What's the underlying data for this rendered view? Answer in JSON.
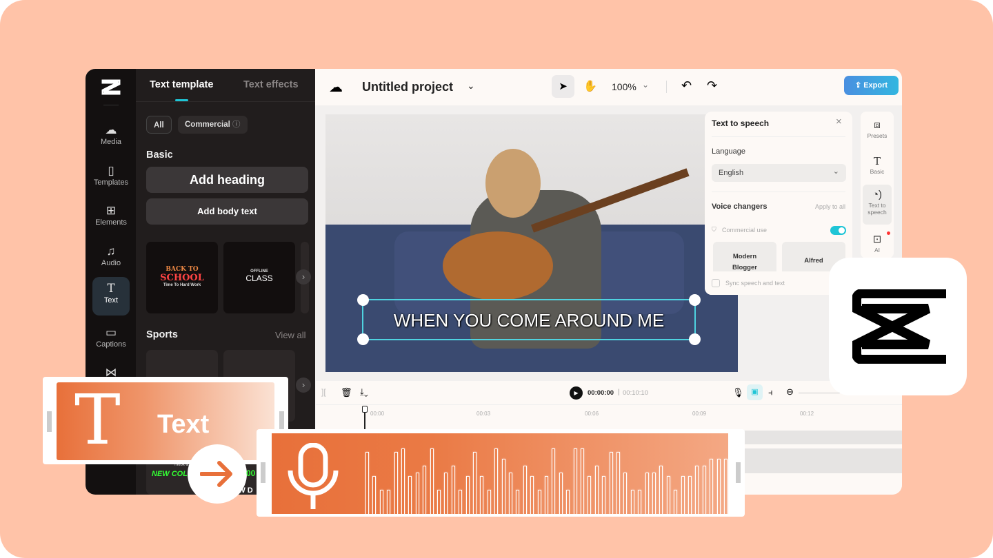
{
  "sidebar": {
    "items": [
      {
        "label": "Media",
        "icon": "cloud-upload-icon"
      },
      {
        "label": "Templates",
        "icon": "templates-icon"
      },
      {
        "label": "Elements",
        "icon": "elements-icon"
      },
      {
        "label": "Audio",
        "icon": "music-note-icon"
      },
      {
        "label": "Text",
        "icon": "text-icon",
        "active": true
      },
      {
        "label": "Captions",
        "icon": "captions-icon"
      },
      {
        "label": "Transitions",
        "icon": "transitions-icon"
      }
    ]
  },
  "panel": {
    "tabs": [
      "Text template",
      "Text effects"
    ],
    "filters": [
      "All",
      "Commercial"
    ],
    "basic_heading": "Basic",
    "add_heading": "Add heading",
    "add_body": "Add body text",
    "templates": [
      {
        "line1": "BACK TO",
        "line2": "SCHOOL",
        "line3": "Time To Hard Work"
      },
      {
        "line1": "OFFLINE",
        "line2": "CLASS"
      }
    ],
    "sports_heading": "Sports",
    "view_all": "View all",
    "sports_thumb_text": [
      "Tiktok & Bro",
      "NEW COLLEC",
      "00",
      "EW D"
    ]
  },
  "header": {
    "project_title": "Untitled project",
    "zoom": "100%",
    "export": "Export"
  },
  "canvas": {
    "caption": "WHEN  YOU COME AROUND ME"
  },
  "tts": {
    "title": "Text to speech",
    "language_label": "Language",
    "language_value": "English",
    "voice_label": "Voice changers",
    "apply_all": "Apply to all",
    "commercial": "Commercial use",
    "commercial_on": true,
    "voices": [
      "Modern Blogger",
      "Alfred"
    ],
    "sync": "Sync speech and text"
  },
  "right_rail": [
    {
      "label": "Presets",
      "icon": "presets-icon"
    },
    {
      "label": "Basic",
      "icon": "text-icon"
    },
    {
      "label": "Text to speech",
      "icon": "speaking-head-icon",
      "active": true
    },
    {
      "label": "AI",
      "icon": "ai-avatar-icon"
    }
  ],
  "timeline": {
    "current": "00:00:00",
    "total": "00:10:10",
    "ticks": [
      "00:00",
      "00:03",
      "00:06",
      "00:09",
      "00:12"
    ]
  },
  "overlay": {
    "text_label": "Text"
  },
  "colors": {
    "accent": "#1fc5d6",
    "orange": "#e8703a",
    "peach": "#ffc3a8",
    "export": "#3f9ee6"
  },
  "waveform_levels": [
    0.9,
    0.55,
    0.35,
    0.35,
    0.9,
    0.95,
    0.55,
    0.6,
    0.7,
    0.95,
    0.35,
    0.6,
    0.7,
    0.35,
    0.55,
    0.9,
    0.55,
    0.35,
    0.95,
    0.8,
    0.6,
    0.35,
    0.7,
    0.55,
    0.35,
    0.55,
    0.95,
    0.6,
    0.35,
    0.95,
    0.95,
    0.55,
    0.7,
    0.55,
    0.9,
    0.9,
    0.6,
    0.35,
    0.35,
    0.6,
    0.6,
    0.7,
    0.55,
    0.35,
    0.55,
    0.55,
    0.7,
    0.7,
    0.8,
    0.8,
    0.8
  ]
}
